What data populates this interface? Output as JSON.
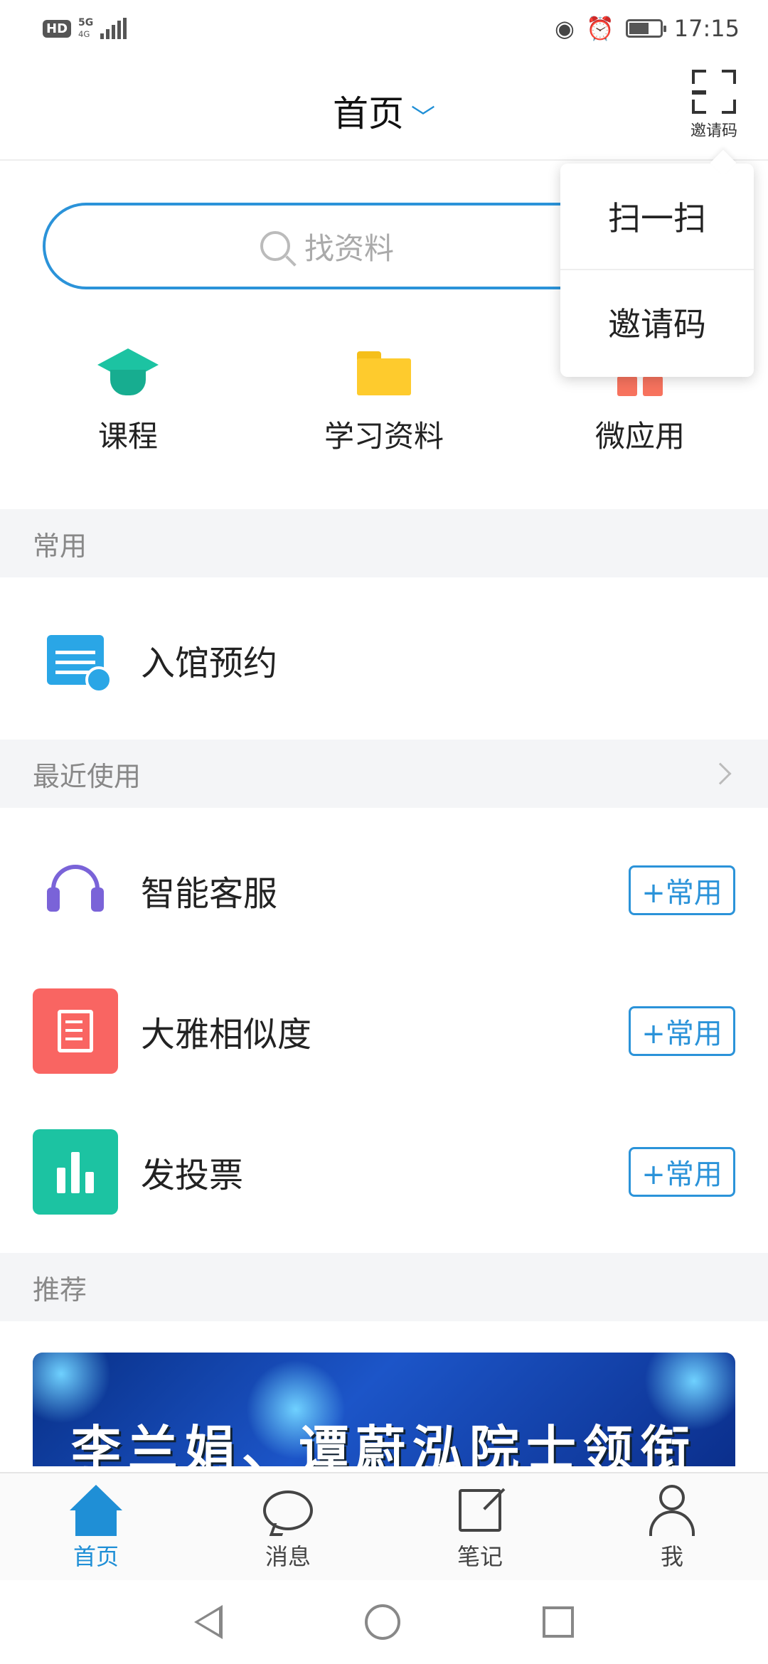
{
  "status_bar": {
    "hd": "HD",
    "network": "5G",
    "network_sub": "4G",
    "time": "17:15"
  },
  "header": {
    "title": "首页",
    "scan_label": "邀请码"
  },
  "popup": {
    "items": [
      "扫一扫",
      "邀请码"
    ]
  },
  "search": {
    "placeholder": "找资料"
  },
  "quick_entries": [
    {
      "label": "课程",
      "icon": "graduation-cap-icon",
      "color": "#1cc3a2"
    },
    {
      "label": "学习资料",
      "icon": "folder-icon",
      "color": "#fecb2d"
    },
    {
      "label": "微应用",
      "icon": "apps-grid-icon",
      "color": "#f7735e"
    }
  ],
  "sections": {
    "common": "常用",
    "recent": "最近使用",
    "recommend": "推荐"
  },
  "common_items": [
    {
      "label": "入馆预约",
      "icon": "calendar-clock-icon"
    }
  ],
  "recent_items": [
    {
      "label": "智能客服",
      "icon": "headset-icon",
      "add_label": "+常用"
    },
    {
      "label": "大雅相似度",
      "icon": "document-check-icon",
      "add_label": "+常用"
    },
    {
      "label": "发投票",
      "icon": "bar-chart-icon",
      "add_label": "+常用"
    }
  ],
  "banner": {
    "text": "李兰娟、谭蔚泓院士领衔"
  },
  "tabbar": [
    {
      "label": "首页",
      "icon": "home-icon",
      "active": true
    },
    {
      "label": "消息",
      "icon": "message-bubble-icon"
    },
    {
      "label": "笔记",
      "icon": "edit-note-icon"
    },
    {
      "label": "我",
      "icon": "user-icon"
    }
  ],
  "colors": {
    "accent": "#1f8fd6",
    "section_bg": "#f4f5f7"
  }
}
